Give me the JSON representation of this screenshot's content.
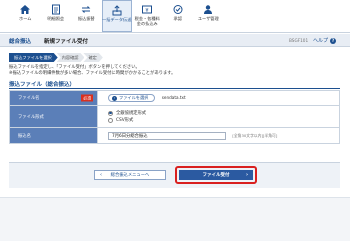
{
  "nav": [
    {
      "label": "ホーム",
      "icon": "home-icon"
    },
    {
      "label": "明細照会",
      "icon": "document-icon"
    },
    {
      "label": "振込振替",
      "icon": "transfer-icon"
    },
    {
      "label": "一括データ伝送",
      "icon": "upload-icon",
      "active": true
    },
    {
      "label": "税金・各種料金の払込み",
      "icon": "payment-icon"
    },
    {
      "label": "承認",
      "icon": "approve-icon"
    },
    {
      "label": "ユーザ管理",
      "icon": "user-icon"
    }
  ],
  "header": {
    "section": "総合振込",
    "title": "新規ファイル受付",
    "screen_id": "BSGF101",
    "help": "ヘルプ"
  },
  "steps": [
    "振込ファイルを選択",
    "内容確認",
    "確定"
  ],
  "instructions": [
    "振込ファイルを指定し、「ファイル受付」ボタンを押してください。",
    "※振込ファイルの明細件数が多い場合、ファイル受付に時間がかかることがあります。"
  ],
  "form": {
    "title": "振込ファイル（総合振込）",
    "file_label": "ファイル名",
    "required": "必須",
    "file_button": "ファイルを選択",
    "file_name": "sendata.txt",
    "format_label": "ファイル形式",
    "format_options": [
      "全銀協規定形式",
      "CSV形式"
    ],
    "format_selected": 0,
    "transfer_label": "振込名",
    "transfer_value": "7月6日分総合振込",
    "transfer_hint": "[全角30文字以内][半角可]"
  },
  "actions": {
    "back": "総合振込メニューへ",
    "submit": "ファイル受付"
  },
  "colors": {
    "accent": "#1c4f8f",
    "primary_button": "#2b5aa1",
    "highlight": "#d9201f"
  }
}
